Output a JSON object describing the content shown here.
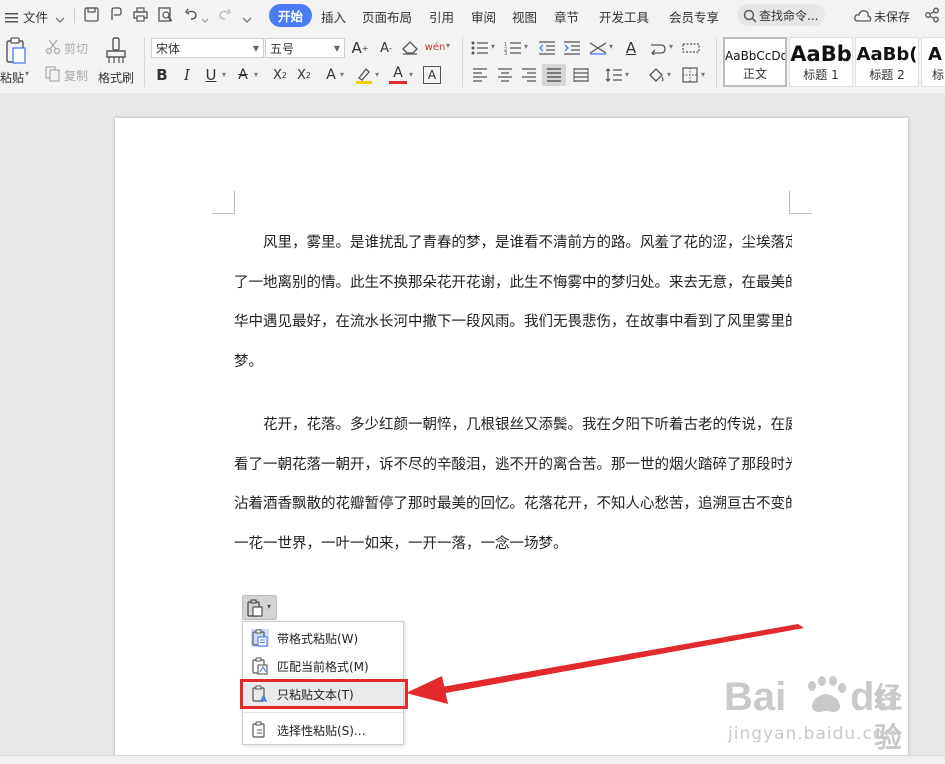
{
  "menubar": {
    "file_label": "文件",
    "tabs": [
      {
        "label": "开始",
        "active": true
      },
      {
        "label": "插入"
      },
      {
        "label": "页面布局"
      },
      {
        "label": "引用"
      },
      {
        "label": "审阅"
      },
      {
        "label": "视图"
      },
      {
        "label": "章节"
      },
      {
        "label": "开发工具"
      },
      {
        "label": "会员专享"
      }
    ],
    "search_label": "查找命令...",
    "unsaved_label": "未保存",
    "accent_color": "#4a7bf7"
  },
  "ribbon": {
    "paste_label": "粘贴",
    "cut_label": "剪切",
    "copy_label": "复制",
    "format_painter_label": "格式刷",
    "font_name": "宋体",
    "font_size": "五号",
    "styles": [
      {
        "sample": "AaBbCcDd",
        "name": "正文",
        "selected": true
      },
      {
        "sample": "AaBb",
        "name": "标题 1"
      },
      {
        "sample": "AaBb(",
        "name": "标题 2"
      },
      {
        "sample": "A",
        "name": "标"
      }
    ]
  },
  "document": {
    "paragraphs": [
      {
        "lines": [
          "风里，雾里。是谁扰乱了青春的梦，是谁看不清前方的路。风羞了花的涩，尘埃落定诉",
          "了一地离别的情。此生不换那朵花开花谢，此生不悔雾中的梦归处。来去无意，在最美的年",
          "华中遇见最好，在流水长河中撒下一段风雨。我们无畏悲伤，在故事中看到了风里雾里的旧",
          "梦。"
        ]
      },
      {
        "lines": [
          "花开，花落。多少红颜一朝悴，几根银丝又添鬓。我在夕阳下听着古老的传说，在庭间",
          "看了一朝花落一朝开，诉不尽的辛酸泪，逃不开的离合苦。那一世的烟火踏碎了那段时光，",
          "沾着酒香飘散的花瓣暂停了那时最美的回忆。花落花开，不知人心愁苦，追溯亘古不变的梦。",
          "一花一世界，一叶一如来，一开一落，一念一场梦。"
        ]
      }
    ]
  },
  "paste_menu": {
    "items": [
      {
        "label": "带格式粘贴(W)",
        "icon": "paste-with-format-icon"
      },
      {
        "label": "匹配当前格式(M)",
        "icon": "paste-match-format-icon"
      },
      {
        "label": "只粘贴文本(T)",
        "icon": "paste-text-only-icon",
        "highlighted": true
      },
      {
        "label": "选择性粘贴(S)...",
        "icon": "paste-special-icon"
      }
    ],
    "highlight_color": "#e2292b"
  },
  "watermark": {
    "brand": "Bai",
    "brand2": "du",
    "cn": "经验",
    "url": "jingyan.baidu.com"
  }
}
